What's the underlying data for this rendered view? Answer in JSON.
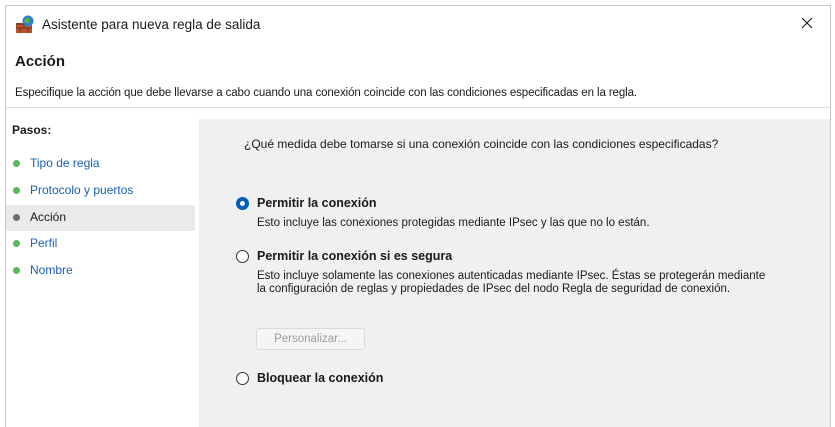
{
  "window": {
    "title": "Asistente para nueva regla de salida"
  },
  "header": {
    "title": "Acción",
    "description": "Especifique la acción que debe llevarse a cabo cuando una conexión coincide con las condiciones especificadas en la regla."
  },
  "steps": {
    "title": "Pasos:",
    "items": [
      {
        "label": "Tipo de regla",
        "active": false
      },
      {
        "label": "Protocolo y puertos",
        "active": false
      },
      {
        "label": "Acción",
        "active": true
      },
      {
        "label": "Perfil",
        "active": false
      },
      {
        "label": "Nombre",
        "active": false
      }
    ]
  },
  "main": {
    "question": "¿Qué medida debe tomarse si una conexión coincide con las condiciones especificadas?",
    "options": [
      {
        "label": "Permitir la conexión",
        "description": "Esto incluye las conexiones protegidas mediante IPsec y las que no lo están.",
        "selected": true
      },
      {
        "label": "Permitir la conexión si es segura",
        "description": "Esto incluye solamente las conexiones autenticadas mediante IPsec. Éstas se protegerán mediante la configuración de reglas y propiedades de IPsec del nodo Regla de seguridad de conexión.",
        "selected": false
      },
      {
        "label": "Bloquear la conexión",
        "selected": false
      }
    ],
    "customize_button": "Personalizar..."
  },
  "colors": {
    "accent": "#005fb8",
    "step_done_dot": "#5cb85c",
    "step_active_dot": "#6e6e6e",
    "content_background": "#f0f0f0"
  },
  "icons": {
    "app": "firewall-icon",
    "close": "close-icon"
  }
}
